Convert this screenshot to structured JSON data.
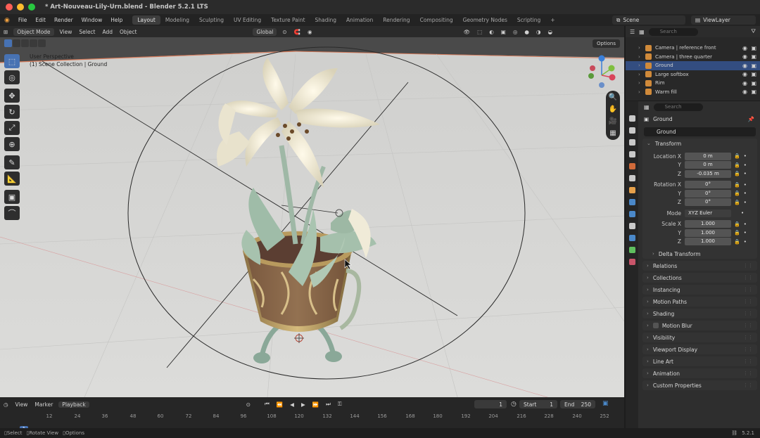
{
  "window": {
    "title": "* Art-Nouveau-Lily-Urn.blend - Blender 5.2.1 LTS",
    "traffic_colors": [
      "#ff5f57",
      "#febc2e",
      "#28c840"
    ]
  },
  "menubar": {
    "items": [
      "File",
      "Edit",
      "Render",
      "Window",
      "Help"
    ],
    "workspaces": [
      "Layout",
      "Modeling",
      "Sculpting",
      "UV Editing",
      "Texture Paint",
      "Shading",
      "Animation",
      "Rendering",
      "Compositing",
      "Geometry Nodes",
      "Scripting"
    ],
    "active_workspace": "Layout",
    "scene": "Scene",
    "view_layer": "ViewLayer"
  },
  "viewport": {
    "mode": "Object Mode",
    "menus": [
      "View",
      "Select",
      "Add",
      "Object"
    ],
    "orientation": "Global",
    "options": "Options",
    "info_line1": "User Perspective",
    "info_line2": "(1) Scene Collection | Ground"
  },
  "timeline": {
    "menus": [
      "View",
      "Marker",
      "Playback"
    ],
    "current_frame": "1",
    "start_label": "Start",
    "start": "1",
    "end_label": "End",
    "end": "250",
    "ticks": [
      "12",
      "24",
      "36",
      "48",
      "60",
      "72",
      "84",
      "96",
      "108",
      "120",
      "132",
      "144",
      "156",
      "168",
      "180",
      "192",
      "204",
      "216",
      "228",
      "240",
      "252"
    ],
    "cursor_label": "1"
  },
  "statusbar": {
    "items": [
      "Select",
      "Rotate View",
      "Options"
    ],
    "version": "5.2.1"
  },
  "outliner": {
    "search_placeholder": "Search",
    "rows": [
      {
        "label": "Camera | reference front",
        "selected": false
      },
      {
        "label": "Camera | three quarter",
        "selected": false
      },
      {
        "label": "Ground",
        "selected": true
      },
      {
        "label": "Large softbox",
        "selected": false
      },
      {
        "label": "Rim",
        "selected": false
      },
      {
        "label": "Warm fill",
        "selected": false
      }
    ]
  },
  "properties": {
    "search_placeholder": "Search",
    "object_title": "Ground",
    "object_field": "Ground",
    "transform_title": "Transform",
    "location_label": "Location X",
    "location": [
      "0 m",
      "0 m",
      "-0.035 m"
    ],
    "rotation_label": "Rotation X",
    "rotation": [
      "0°",
      "0°",
      "0°"
    ],
    "mode_label": "Mode",
    "mode_value": "XYZ Euler",
    "scale_label": "Scale X",
    "scale": [
      "1.000",
      "1.000",
      "1.000"
    ],
    "axis_y": "Y",
    "axis_z": "Z",
    "delta_transform": "Delta Transform",
    "panels": [
      "Relations",
      "Collections",
      "Instancing",
      "Motion Paths",
      "Shading",
      "Motion Blur",
      "Visibility",
      "Viewport Display",
      "Line Art",
      "Animation",
      "Custom Properties"
    ],
    "tab_colors": [
      "#c9c9c9",
      "#c9c9c9",
      "#c9c9c9",
      "#c9c9c9",
      "#d06a3a",
      "#c9c9c9",
      "#e6a04a",
      "#4a88c9",
      "#4a88c9",
      "#c9c9c9",
      "#4a88c9",
      "#5fbf5f",
      "#c9556a"
    ]
  }
}
